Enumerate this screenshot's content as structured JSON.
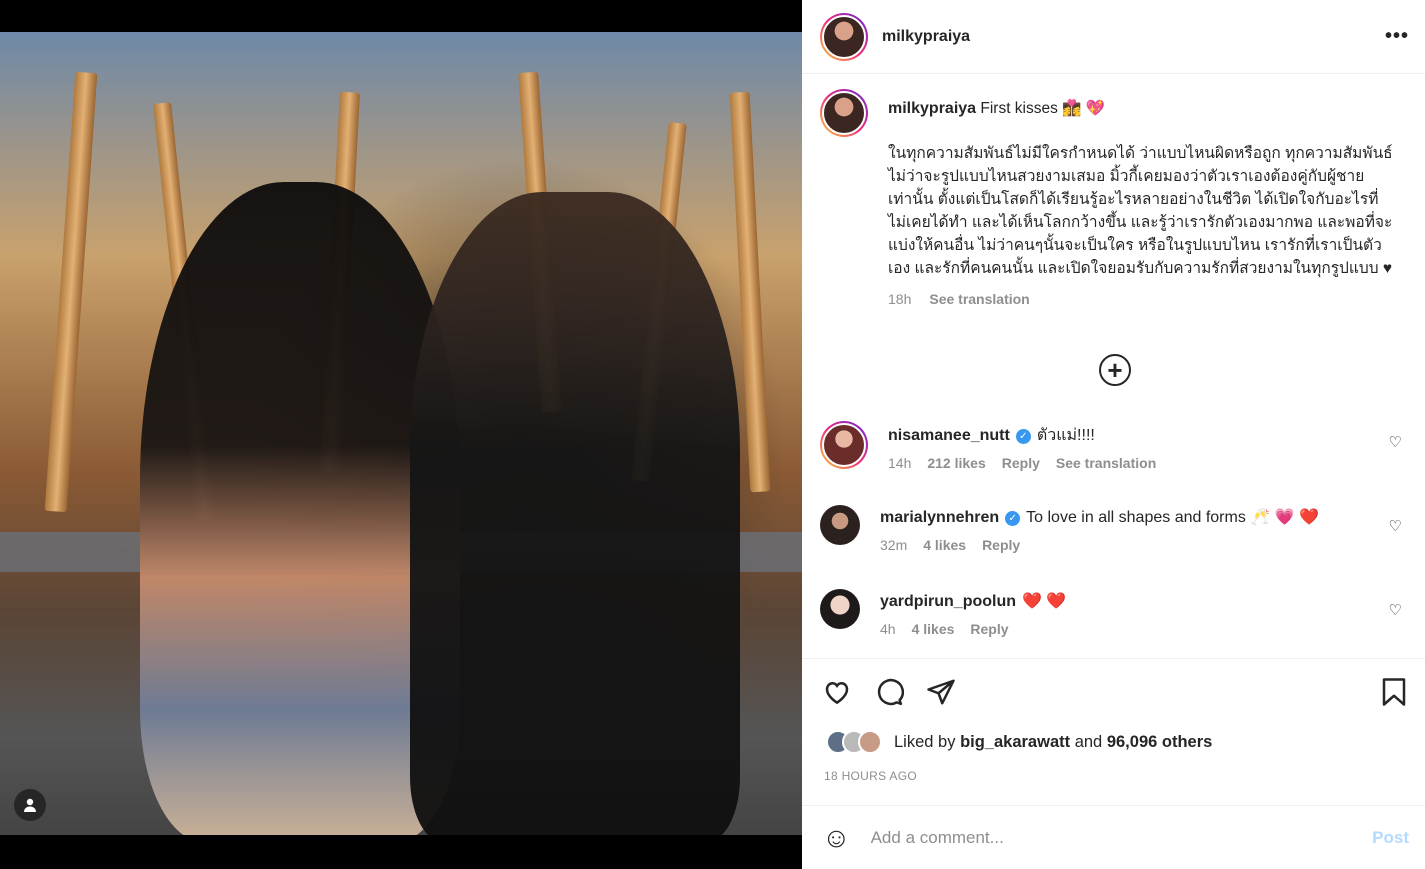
{
  "post": {
    "author": "milkypraiya",
    "more_label": "•••",
    "caption_head": "First kisses 👩‍❤️‍💋‍👩 💖",
    "caption_body": "ในทุกความสัมพันธ์ไม่มีใครกำหนดได้ ว่าแบบไหนผิดหรือถูก ทุกความสัมพันธ์ไม่ว่าจะรูปแบบไหนสวยงามเสมอ มิ้วกี้เคยมองว่าตัวเราเองต้องคู่กับผู้ชายเท่านั้น ตั้งแต่เป็นโสดก็ได้เรียนรู้อะไรหลายอย่างในชีวิต ได้เปิดใจกับอะไรที่ไม่เคยได้ทำ และได้เห็นโลกกว้างขึ้น และรู้ว่าเรารักตัวเองมากพอ และพอที่จะแบ่งให้คนอื่น ไม่ว่าคนๆนั้นจะเป็นใคร หรือในรูปแบบไหน เรารักที่เราเป็นตัวเอง และรักที่คนคนนั้น และเปิดใจยอมรับกับความรักที่สวยงามในทุกรูปแบบ ♥",
    "caption_time": "18h",
    "see_translation": "See translation",
    "load_more_icon": "plus-circle-icon"
  },
  "comments": [
    {
      "user": "nisamanee_nutt",
      "verified": true,
      "text": "ตัวแม่!!!!",
      "time": "14h",
      "likes": "212 likes",
      "reply": "Reply",
      "translate": "See translation"
    },
    {
      "user": "marialynnehren",
      "verified": true,
      "text": "To love in all shapes and forms 🥂 💗 ❤️",
      "time": "32m",
      "likes": "4 likes",
      "reply": "Reply"
    },
    {
      "user": "yardpirun_poolun",
      "verified": false,
      "text": "❤️ ❤️",
      "time": "4h",
      "likes": "4 likes",
      "reply": "Reply"
    }
  ],
  "actions": {
    "liked_by_prefix": "Liked by",
    "liked_by_user": "big_akarawatt",
    "liked_by_and": "and",
    "liked_by_others": "96,096 others",
    "timestamp": "18 HOURS AGO"
  },
  "composer": {
    "placeholder": "Add a comment...",
    "post_label": "Post"
  },
  "colors": {
    "link_blue": "#3897f0",
    "post_disabled": "#b3dbff",
    "muted_text": "#8e8e8e"
  }
}
